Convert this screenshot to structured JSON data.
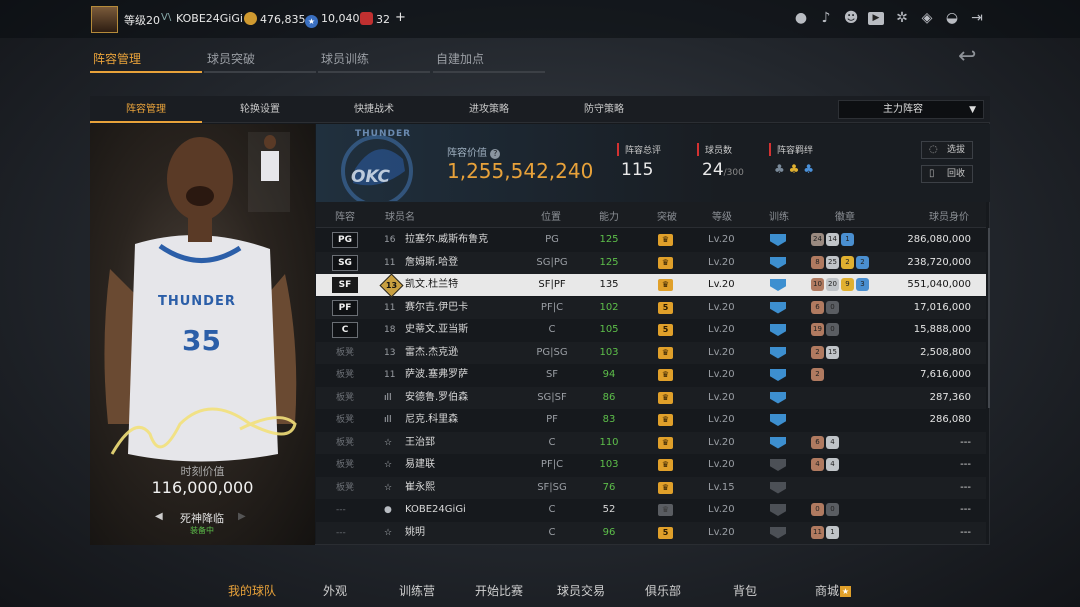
{
  "topbar": {
    "level_label": "等级20",
    "username": "KOBE24GiGi",
    "gold": "476,835",
    "points": "10,040",
    "tickets": "32",
    "plus": "+"
  },
  "main_tabs": [
    {
      "label": "阵容管理",
      "active": true
    },
    {
      "label": "球员突破",
      "active": false
    },
    {
      "label": "球员训练",
      "active": false
    },
    {
      "label": "自建加点",
      "active": false
    }
  ],
  "sub_tabs": [
    {
      "label": "阵容管理",
      "active": true
    },
    {
      "label": "轮换设置",
      "active": false
    },
    {
      "label": "快捷战术",
      "active": false
    },
    {
      "label": "进攻策略",
      "active": false
    },
    {
      "label": "防守策略",
      "active": false
    }
  ],
  "lineup_select": "主力阵容",
  "card": {
    "jersey_number": "35",
    "team_text": "THUNDER",
    "value_label": "时刻价值",
    "value": "116,000,000",
    "skill_name": "死神降临",
    "skill_status": "装备中"
  },
  "team": {
    "logo_text": "OKC",
    "logo_top": "THUNDER",
    "value_label": "阵容价值",
    "value": "1,255,542,240",
    "rating_label": "阵容总评",
    "rating": "115",
    "count_label": "球员数",
    "count": "24",
    "count_max": "/300",
    "bond_label": "阵容羁绊",
    "btn_select": "选拔",
    "btn_recycle": "回收"
  },
  "table_headers": [
    "阵容",
    "球员名",
    "位置",
    "能力",
    "突破",
    "等级",
    "训练",
    "徽章",
    "球员身价"
  ],
  "players": [
    {
      "slot": "PG",
      "num": "16",
      "name": "拉塞尔.威斯布鲁克",
      "pos": "PG",
      "ability": "125",
      "break": "crown",
      "level": "Lv.20",
      "train": "blue",
      "badges": [
        [
          "24",
          "#9a8a80"
        ],
        [
          "14",
          "#c0c4c8"
        ],
        [
          "1",
          "#4a8fd0"
        ]
      ],
      "value": "286,080,000"
    },
    {
      "slot": "SG",
      "num": "11",
      "name": "詹姆斯.哈登",
      "pos": "SG|PG",
      "ability": "125",
      "break": "crown",
      "level": "Lv.20",
      "train": "blue",
      "badges": [
        [
          "8",
          "#b07a60"
        ],
        [
          "25",
          "#c0c4c8"
        ],
        [
          "2",
          "#e0b030"
        ],
        [
          "2",
          "#4a8fd0"
        ]
      ],
      "value": "238,720,000"
    },
    {
      "slot": "SF",
      "num": "13",
      "name": "凯文.杜兰特",
      "pos": "SF|PF",
      "ability": "135",
      "break": "crown",
      "level": "Lv.20",
      "train": "blue",
      "badges": [
        [
          "10",
          "#b07a60"
        ],
        [
          "20",
          "#c0c4c8"
        ],
        [
          "9",
          "#e0b030"
        ],
        [
          "3",
          "#4a8fd0"
        ]
      ],
      "value": "551,040,000",
      "selected": true
    },
    {
      "slot": "PF",
      "num": "11",
      "name": "赛尔吉.伊巴卡",
      "pos": "PF|C",
      "ability": "102",
      "break": "5",
      "level": "Lv.20",
      "train": "blue",
      "badges": [
        [
          "6",
          "#b07a60"
        ],
        [
          "0",
          "#5a5d62"
        ]
      ],
      "value": "17,016,000"
    },
    {
      "slot": "C",
      "num": "18",
      "name": "史蒂文.亚当斯",
      "pos": "C",
      "ability": "105",
      "break": "5",
      "level": "Lv.20",
      "train": "blue",
      "badges": [
        [
          "19",
          "#b07a60"
        ],
        [
          "0",
          "#5a5d62"
        ]
      ],
      "value": "15,888,000"
    },
    {
      "bench": "板凳",
      "num": "13",
      "name": "雷杰.杰克逊",
      "pos": "PG|SG",
      "ability": "103",
      "break": "crown",
      "level": "Lv.20",
      "train": "blue",
      "badges": [
        [
          "2",
          "#b07a60"
        ],
        [
          "15",
          "#c0c4c8"
        ]
      ],
      "value": "2,508,800"
    },
    {
      "bench": "板凳",
      "num": "11",
      "name": "萨波.塞弗罗萨",
      "pos": "SF",
      "ability": "94",
      "break": "crown",
      "level": "Lv.20",
      "train": "blue",
      "badges": [
        [
          "2",
          "#b07a60"
        ]
      ],
      "value": "7,616,000"
    },
    {
      "bench": "板凳",
      "icon": "bars",
      "name": "安德鲁.罗伯森",
      "pos": "SG|SF",
      "ability": "86",
      "break": "crown",
      "level": "Lv.20",
      "train": "blue",
      "badges": [],
      "value": "287,360"
    },
    {
      "bench": "板凳",
      "icon": "bars",
      "name": "尼克.科里森",
      "pos": "PF",
      "ability": "83",
      "break": "crown",
      "level": "Lv.20",
      "train": "blue",
      "badges": [],
      "value": "286,080"
    },
    {
      "bench": "板凳",
      "icon": "star",
      "name": "王治郅",
      "pos": "C",
      "ability": "110",
      "break": "crown",
      "level": "Lv.20",
      "train": "blue",
      "badges": [
        [
          "6",
          "#b07a60"
        ],
        [
          "4",
          "#c0c4c8"
        ]
      ],
      "value": "---"
    },
    {
      "bench": "板凳",
      "icon": "star",
      "name": "易建联",
      "pos": "PF|C",
      "ability": "103",
      "break": "crown",
      "level": "Lv.20",
      "train": "gray",
      "badges": [
        [
          "4",
          "#b07a60"
        ],
        [
          "4",
          "#c0c4c8"
        ]
      ],
      "value": "---"
    },
    {
      "bench": "板凳",
      "icon": "star",
      "name": "崔永熙",
      "pos": "SF|SG",
      "ability": "76",
      "break": "crown",
      "level": "Lv.15",
      "train": "gray",
      "badges": [],
      "value": "---"
    },
    {
      "bench": "---",
      "icon": "person",
      "name": "KOBE24GiGi",
      "pos": "C",
      "ability": "52",
      "break": "dim",
      "level": "Lv.20",
      "train": "gray",
      "badges": [
        [
          "0",
          "#b07a60"
        ],
        [
          "0",
          "#5a5d62"
        ]
      ],
      "value": "---",
      "ability_white": true
    },
    {
      "bench": "---",
      "icon": "star",
      "name": "姚明",
      "pos": "C",
      "ability": "96",
      "break": "5",
      "level": "Lv.20",
      "train": "gray",
      "badges": [
        [
          "11",
          "#b07a60"
        ],
        [
          "1",
          "#c0c4c8"
        ]
      ],
      "value": "---"
    }
  ],
  "bottom_nav": [
    {
      "label": "我的球队",
      "active": true
    },
    {
      "label": "外观"
    },
    {
      "label": "训练营"
    },
    {
      "label": "开始比赛"
    },
    {
      "label": "球员交易"
    },
    {
      "label": "俱乐部"
    },
    {
      "label": "背包"
    },
    {
      "label": "商城"
    }
  ],
  "colors": {
    "accent": "#e8a23a",
    "ability_green": "#5dbf4a",
    "bond_red": "#d43232",
    "train_blue": "#3d8fd0"
  }
}
